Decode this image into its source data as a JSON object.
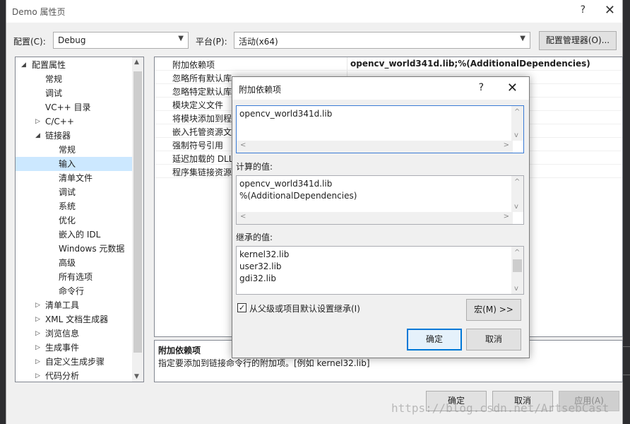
{
  "window": {
    "title": "Demo 属性页",
    "help": "?",
    "close": "✕"
  },
  "config": {
    "label": "配置(C):",
    "value": "Debug",
    "platform_label": "平台(P):",
    "platform_value": "活动(x64)",
    "manager_button": "配置管理器(O)..."
  },
  "tree": {
    "items": [
      {
        "label": "配置属性",
        "exp": "◢"
      },
      {
        "label": "常规",
        "exp": ""
      },
      {
        "label": "调试",
        "exp": ""
      },
      {
        "label": "VC++ 目录",
        "exp": ""
      },
      {
        "label": "C/C++",
        "exp": "▷"
      },
      {
        "label": "链接器",
        "exp": "◢"
      },
      {
        "label": "常规",
        "exp": ""
      },
      {
        "label": "输入",
        "exp": ""
      },
      {
        "label": "清单文件",
        "exp": ""
      },
      {
        "label": "调试",
        "exp": ""
      },
      {
        "label": "系统",
        "exp": ""
      },
      {
        "label": "优化",
        "exp": ""
      },
      {
        "label": "嵌入的 IDL",
        "exp": ""
      },
      {
        "label": "Windows 元数据",
        "exp": ""
      },
      {
        "label": "高级",
        "exp": ""
      },
      {
        "label": "所有选项",
        "exp": ""
      },
      {
        "label": "命令行",
        "exp": ""
      },
      {
        "label": "清单工具",
        "exp": "▷"
      },
      {
        "label": "XML 文档生成器",
        "exp": "▷"
      },
      {
        "label": "浏览信息",
        "exp": "▷"
      },
      {
        "label": "生成事件",
        "exp": "▷"
      },
      {
        "label": "自定义生成步骤",
        "exp": "▷"
      },
      {
        "label": "代码分析",
        "exp": "▷"
      }
    ]
  },
  "properties": [
    {
      "name": "附加依赖项",
      "value": "opencv_world341d.lib;%(AdditionalDependencies)"
    },
    {
      "name": "忽略所有默认库",
      "value": ""
    },
    {
      "name": "忽略特定默认库",
      "value": ""
    },
    {
      "name": "模块定义文件",
      "value": ""
    },
    {
      "name": "将模块添加到程",
      "value": ""
    },
    {
      "name": "嵌入托管资源文",
      "value": ""
    },
    {
      "name": "强制符号引用",
      "value": ""
    },
    {
      "name": "延迟加载的 DLL",
      "value": ""
    },
    {
      "name": "程序集链接资源",
      "value": ""
    }
  ],
  "description": {
    "title": "附加依赖项",
    "text": "指定要添加到链接命令行的附加项。[例如 kernel32.lib]"
  },
  "buttons": {
    "ok": "确定",
    "cancel": "取消",
    "apply": "应用(A)"
  },
  "dialog": {
    "title": "附加依赖项",
    "help": "?",
    "close": "✕",
    "edit_lines": [
      "opencv_world341d.lib"
    ],
    "computed_label": "计算的值:",
    "computed_lines": [
      "opencv_world341d.lib",
      "%(AdditionalDependencies)"
    ],
    "inherited_label": "继承的值:",
    "inherited_lines": [
      "kernel32.lib",
      "user32.lib",
      "gdi32.lib"
    ],
    "inherit_checkbox": "从父级或项目默认设置继承(I)",
    "inherit_checked": true,
    "macro_button": "宏(M) >>",
    "ok_button": "确定",
    "cancel_button": "取消"
  },
  "watermark": "https://blog.csdn.net/ArtsebCast"
}
